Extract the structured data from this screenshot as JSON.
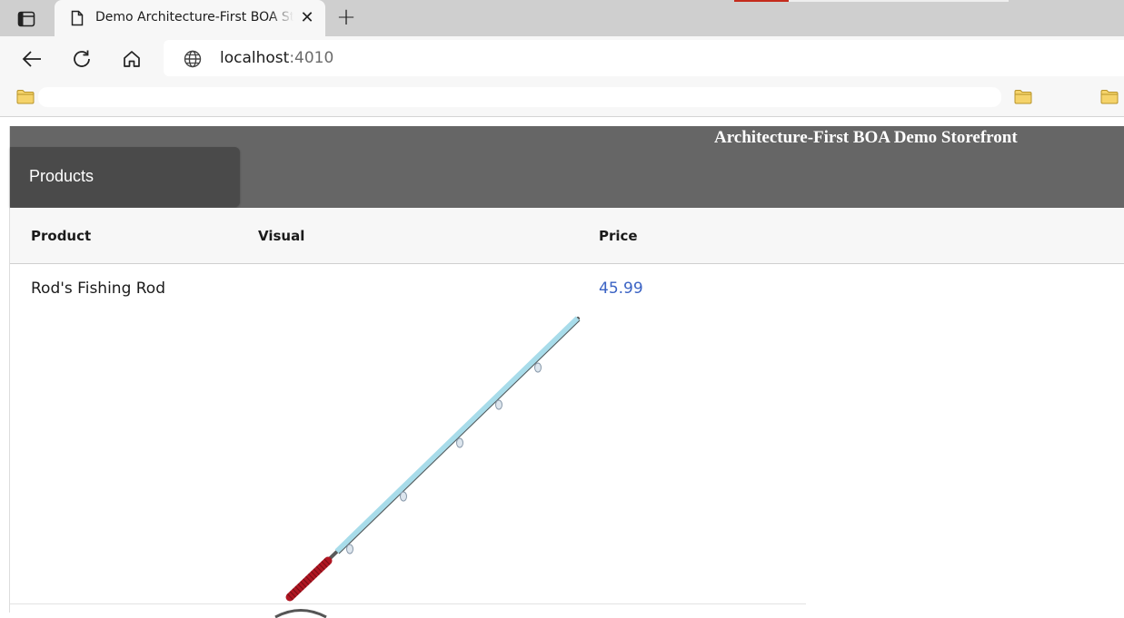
{
  "browser": {
    "tab": {
      "title": "Demo Architecture-First BOA Storefront"
    },
    "address": {
      "host": "localhost",
      "port": ":4010"
    }
  },
  "site": {
    "title": "Architecture-First BOA Demo Storefront",
    "nav": {
      "products_label": "Products"
    }
  },
  "table": {
    "columns": [
      "Product",
      "Visual",
      "Price"
    ],
    "rows": [
      {
        "product": "Rod's Fishing Rod",
        "price": "45.99"
      }
    ]
  },
  "colors": {
    "header_bg": "#666666",
    "nav_active_bg": "#4a4a4a",
    "price_link": "#3b63c4"
  }
}
